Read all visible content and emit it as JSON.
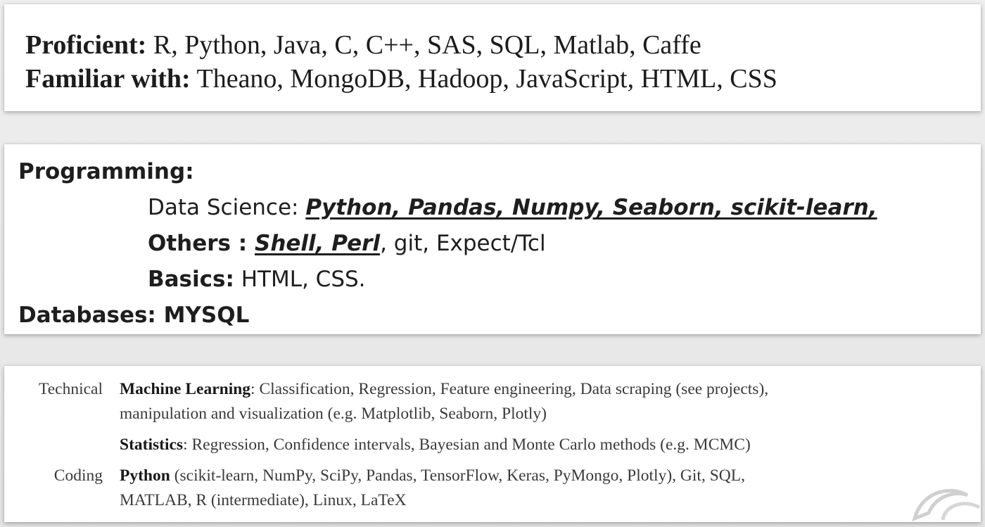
{
  "panel1": {
    "proficient_label": "Proficient:",
    "proficient_items": " R, Python, Java, C, C++, SAS, SQL, Matlab, Caffe",
    "familiar_label": "Familiar with:",
    "familiar_items": " Theano, MongoDB, Hadoop, JavaScript, HTML, CSS"
  },
  "panel2": {
    "programming_label": "Programming:",
    "data_science_label": "Data Science",
    "data_science_sep": ": ",
    "data_science_items": "Python, Pandas, Numpy, Seaborn, scikit-learn,",
    "others_label": "Others : ",
    "others_emph": "Shell, Perl",
    "others_rest": ", git, Expect/Tcl",
    "basics_label": "Basics:",
    "basics_items": " HTML, CSS.",
    "databases_label": "Databases: MYSQL"
  },
  "panel3": {
    "technical_label": "Technical",
    "ml_label": "Machine Learning",
    "ml_text_1": ": Classification, Regression, Feature engineering, Data scraping (see projects),",
    "ml_text_2": "manipulation and visualization (e.g. Matplotlib, Seaborn, Plotly)",
    "stats_label": "Statistics",
    "stats_text": ": Regression, Confidence intervals, Bayesian and Monte Carlo methods (e.g. MCMC)",
    "coding_label": "Coding",
    "python_label": "Python",
    "python_text_1": " (scikit-learn, NumPy, SciPy, Pandas, TensorFlow, Keras, PyMongo, Plotly), Git, SQL,",
    "python_text_2": "MATLAB, R (intermediate), Linux, LaTeX"
  },
  "colors": {
    "background": "#e9e9e9",
    "panel": "#ffffff",
    "text": "#1c1c1c"
  }
}
